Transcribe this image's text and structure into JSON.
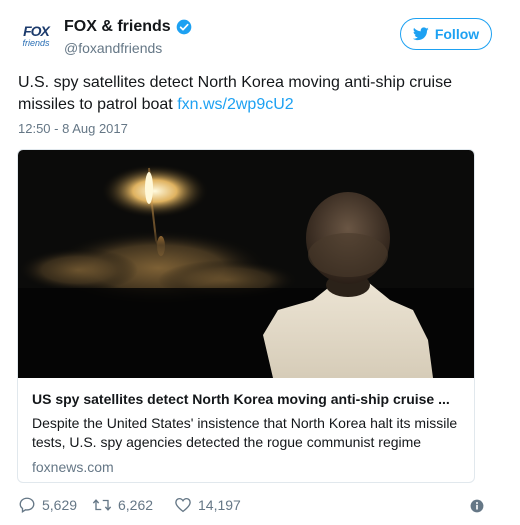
{
  "author": {
    "avatar": {
      "line1": "FOX",
      "line2": "friends"
    },
    "display_name": "FOX & friends",
    "handle": "@foxandfriends",
    "verified_icon": "verified-badge-icon"
  },
  "follow": {
    "label": "Follow",
    "icon": "bird-icon"
  },
  "tweet": {
    "text": "U.S. spy satellites detect North Korea moving anti-ship cruise missiles to patrol boat ",
    "link": "fxn.ws/2wp9cU2",
    "timestamp": "12:50 - 8 Aug 2017"
  },
  "card": {
    "title": "US spy satellites detect North Korea moving anti-ship cruise ...",
    "description": "Despite the United States' insistence that North Korea halt its missile tests, U.S. spy agencies detected the rogue communist regime",
    "domain": "foxnews.com"
  },
  "actions": {
    "replies": "5,629",
    "retweets": "6,262",
    "likes": "14,197",
    "info_icon": "info-icon"
  },
  "colors": {
    "accent": "#1da1f2",
    "text": "#14171a",
    "muted": "#657786",
    "border": "#e1e8ed"
  }
}
